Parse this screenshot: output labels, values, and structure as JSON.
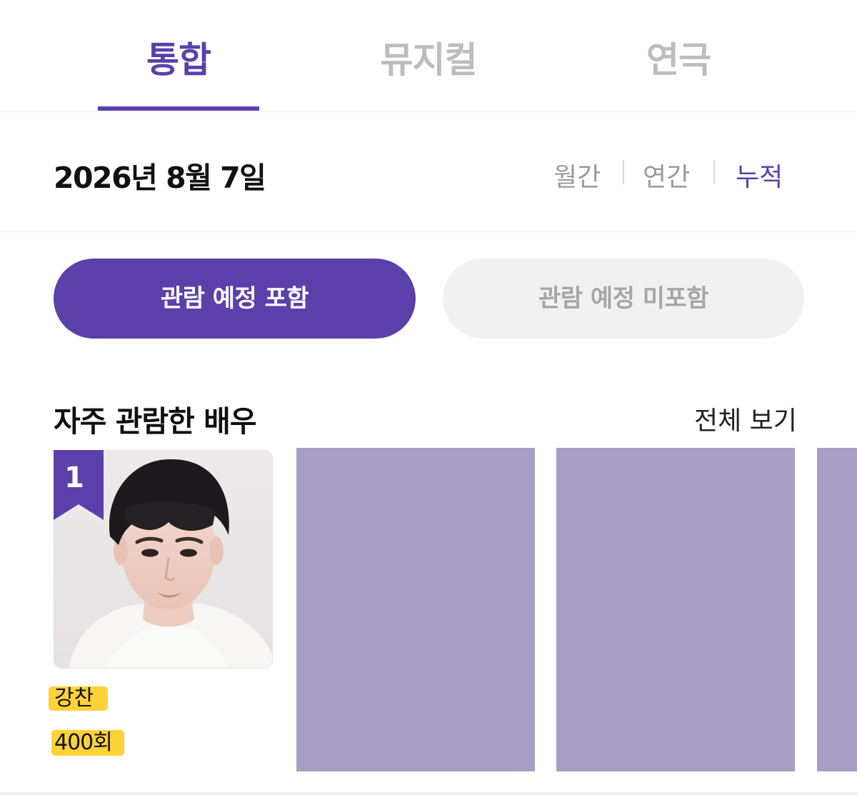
{
  "tabs": [
    {
      "label": "통합",
      "active": true
    },
    {
      "label": "뮤지컬",
      "active": false
    },
    {
      "label": "연극",
      "active": false
    }
  ],
  "date": "2026년 8월 7일",
  "period_filters": [
    {
      "label": "월간",
      "active": false
    },
    {
      "label": "연간",
      "active": false
    },
    {
      "label": "누적",
      "active": true
    }
  ],
  "toggles": {
    "include": "관람 예정 포함",
    "exclude": "관람 예정 미포함",
    "selected": "include"
  },
  "section": {
    "title": "자주 관람한 배우",
    "view_all": "전체 보기"
  },
  "actors": [
    {
      "rank": "1",
      "name": "강찬",
      "count": "400회"
    }
  ],
  "colors": {
    "accent": "#5b40ac",
    "inactive_tab": "#bdbdbd",
    "placeholder": "#a79ec4",
    "highlight": "#ffd238"
  }
}
